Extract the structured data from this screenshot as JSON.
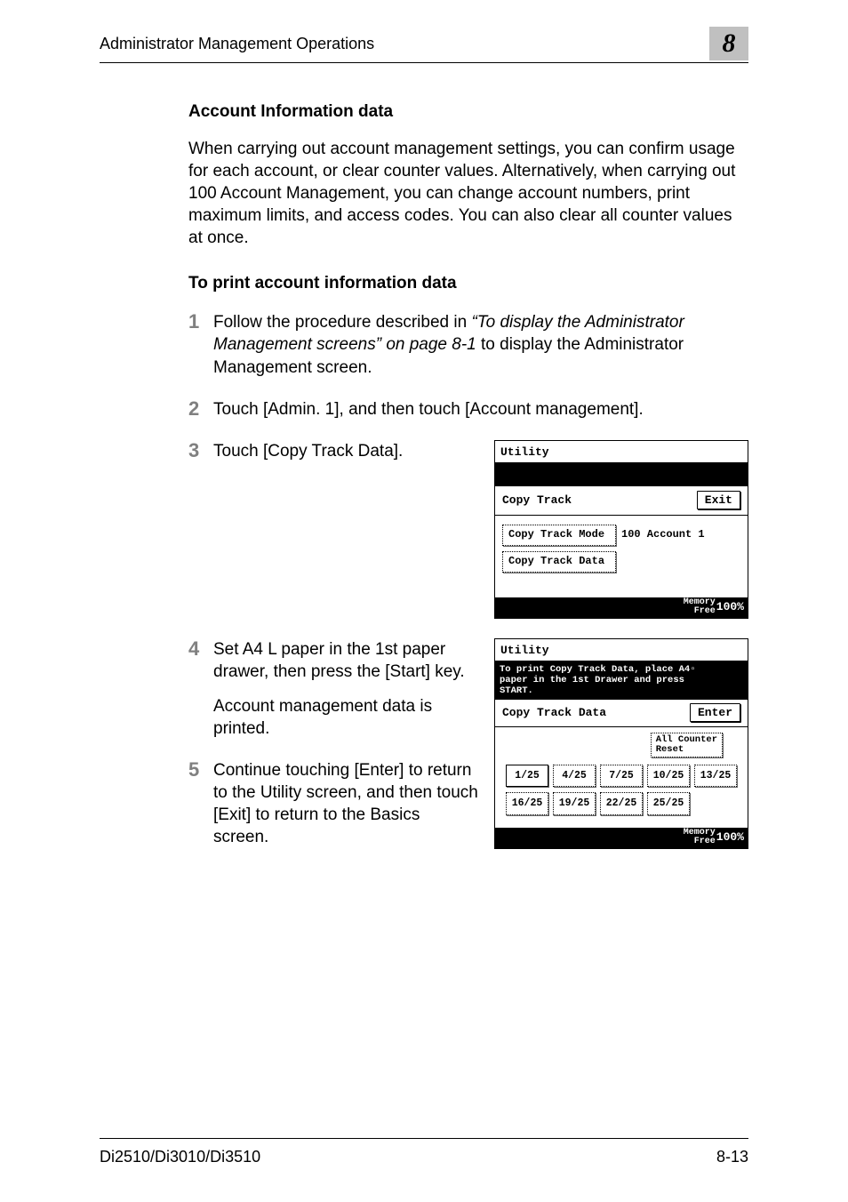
{
  "header": {
    "title": "Administrator Management Operations",
    "chapter": "8"
  },
  "section": {
    "heading": "Account Information data",
    "intro": "When carrying out account management settings, you can confirm usage for each account, or clear counter values. Alternatively, when carrying out 100 Account Management, you can change account numbers, print maximum limits, and access codes. You can also clear all counter values at once.",
    "subheading": "To print account information data"
  },
  "steps": {
    "s1": {
      "num": "1",
      "pre": "Follow the procedure described in ",
      "ref": "“To display the Administrator Management screens” on page 8-1",
      "post": " to display the Administrator Management screen."
    },
    "s2": {
      "num": "2",
      "text": "Touch [Admin. 1], and then touch [Account management]."
    },
    "s3": {
      "num": "3",
      "text": "Touch [Copy Track Data]."
    },
    "s4": {
      "num": "4",
      "line1": "Set A4 L paper in the 1st paper drawer, then press the [Start] key.",
      "line2": "Account management data is printed."
    },
    "s5": {
      "num": "5",
      "text": "Continue touching [Enter] to return to the Utility screen, and then touch [Exit] to return to the Basics screen."
    }
  },
  "shot1": {
    "title": "Utility",
    "heading": "Copy Track",
    "exit": "Exit",
    "mode_btn": "Copy Track Mode",
    "account_info": "100 Account 1",
    "data_btn": "Copy Track Data",
    "mem_label1": "Memory",
    "mem_label2": "Free",
    "mem_val": "100%"
  },
  "shot2": {
    "title": "Utility",
    "instr": "To print Copy Track Data, place A4▫\npaper in the 1st Drawer and press\nSTART.",
    "heading": "Copy Track Data",
    "enter": "Enter",
    "reset": "All Counter\nReset",
    "row1": [
      "1/25",
      "4/25",
      "7/25",
      "10/25",
      "13/25"
    ],
    "row2": [
      "16/25",
      "19/25",
      "22/25",
      "25/25"
    ],
    "mem_label1": "Memory",
    "mem_label2": "Free",
    "mem_val": "100%"
  },
  "footer": {
    "left": "Di2510/Di3010/Di3510",
    "right": "8-13"
  }
}
